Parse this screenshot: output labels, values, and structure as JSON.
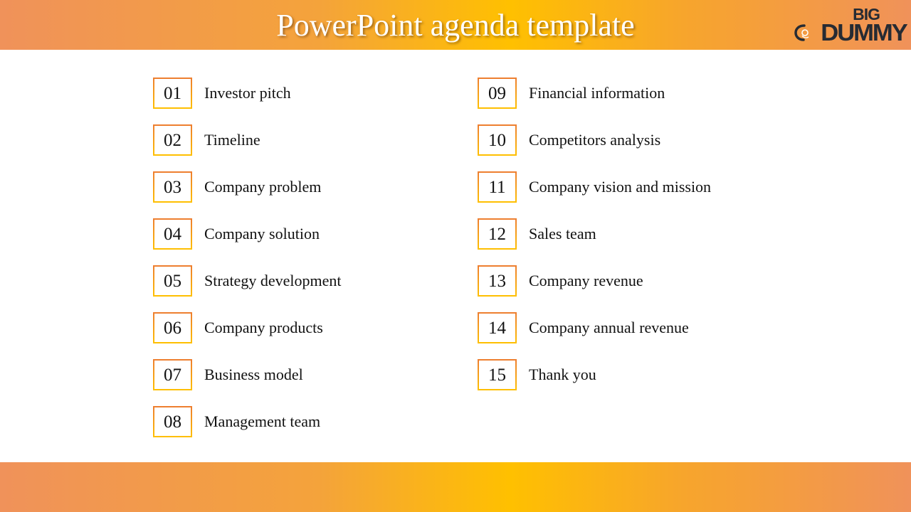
{
  "slide": {
    "title": "PowerPoint agenda template",
    "logo": {
      "line1": "BIG",
      "line2": "DUMMY"
    },
    "colors": {
      "band_orange": "#F0925A",
      "band_gold": "#FFC000",
      "box_border_top": "#ED7D31",
      "box_border_bottom": "#FFC000",
      "text": "#111111",
      "title_text": "#FFFFFF"
    }
  },
  "agenda": {
    "left_column": [
      {
        "number": "01",
        "label": "Investor pitch"
      },
      {
        "number": "02",
        "label": "Timeline"
      },
      {
        "number": "03",
        "label": "Company problem"
      },
      {
        "number": "04",
        "label": "Company solution"
      },
      {
        "number": "05",
        "label": "Strategy development"
      },
      {
        "number": "06",
        "label": "Company products"
      },
      {
        "number": "07",
        "label": "Business model"
      },
      {
        "number": "08",
        "label": "Management team"
      }
    ],
    "right_column": [
      {
        "number": "09",
        "label": "Financial information"
      },
      {
        "number": "10",
        "label": "Competitors analysis"
      },
      {
        "number": "11",
        "label": "Company vision and mission"
      },
      {
        "number": "12",
        "label": "Sales team"
      },
      {
        "number": "13",
        "label": "Company revenue"
      },
      {
        "number": "14",
        "label": "Company annual revenue"
      },
      {
        "number": "15",
        "label": "Thank you"
      }
    ]
  }
}
